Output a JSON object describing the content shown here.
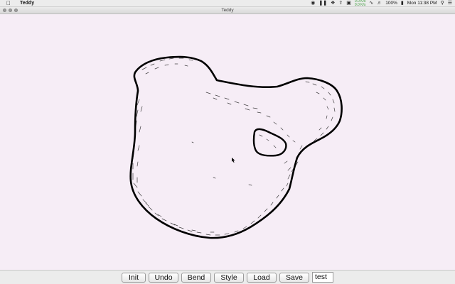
{
  "menubar": {
    "app_name": "Teddy",
    "battery_percent": "100%",
    "clock": "Mon 11:38 PM",
    "icons": [
      "apple-icon",
      "record-icon",
      "pause-icon",
      "dropbox-icon",
      "upload-icon",
      "screen-icon",
      "network-stats-icon",
      "wifi-icon",
      "volume-icon",
      "battery-icon",
      "search-icon",
      "list-icon"
    ],
    "net_stats_up": "0.0 K/s",
    "net_stats_down": "0.0 K/s"
  },
  "window": {
    "title": "Teddy"
  },
  "toolbar": {
    "buttons": [
      "Init",
      "Undo",
      "Bend",
      "Style",
      "Load",
      "Save"
    ],
    "name_field_value": "test"
  },
  "colors": {
    "canvas_background": "#f6edf6",
    "stroke": "#000000"
  }
}
